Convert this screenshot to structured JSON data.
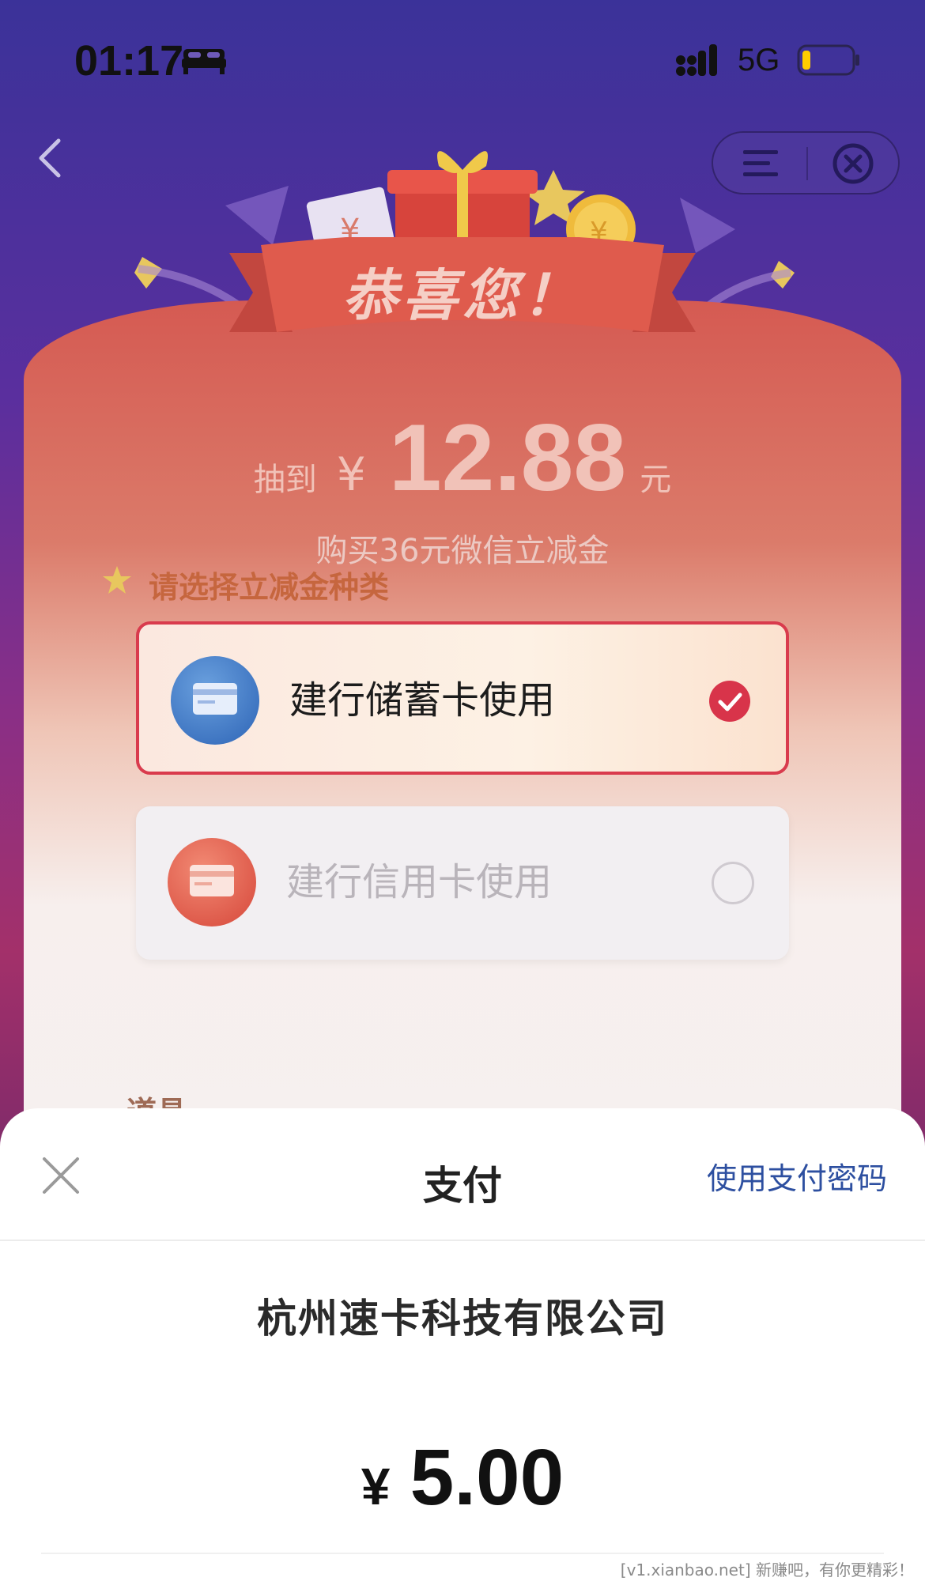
{
  "status_bar": {
    "time": "01:17",
    "network": "5G",
    "icons": [
      "bed-icon",
      "signal-icon",
      "battery-icon"
    ]
  },
  "nav": {
    "back_icon": "chevron-left-icon",
    "capsule_icons": [
      "menu-icon",
      "close-circle-icon"
    ]
  },
  "promo": {
    "congrats": "恭喜您！",
    "prize_prefix": "抽到",
    "currency": "¥",
    "prize_amount": "12.88",
    "prize_unit": "元",
    "buy_text": "购买36元微信立减金",
    "section_title": "请选择立减金种类",
    "options": [
      {
        "label": "建行储蓄卡使用",
        "selected": true,
        "icon": "debit-card-icon"
      },
      {
        "label": "建行信用卡使用",
        "selected": false,
        "icon": "credit-card-icon"
      }
    ],
    "props_label": "道具"
  },
  "payment_sheet": {
    "title": "支付",
    "close_icon": "close-icon",
    "password_link": "使用支付密码",
    "merchant": "杭州速卡科技有限公司",
    "currency": "¥",
    "amount": "5.00"
  },
  "watermark": "[v1.xianbao.net] 新赚吧，有你更精彩！",
  "colors": {
    "selected_border": "#d93b4d",
    "link": "#2d4fa0",
    "background_top": "#3b3299"
  }
}
